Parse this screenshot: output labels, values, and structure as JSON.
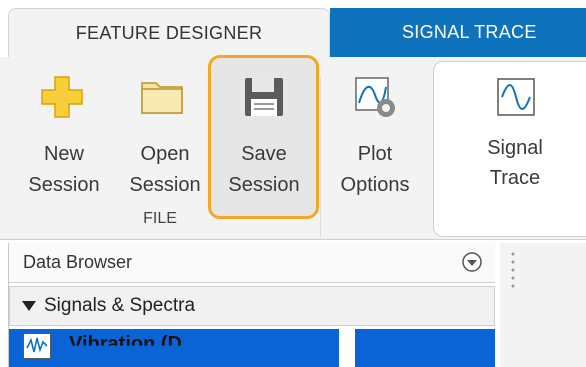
{
  "tabs": {
    "active": "FEATURE DESIGNER",
    "inactive": "SIGNAL TRACE"
  },
  "ribbon": {
    "buttons": [
      {
        "label": "New\nSession",
        "icon": "new-session-icon"
      },
      {
        "label": "Open\nSession",
        "icon": "folder-icon"
      },
      {
        "label": "Save\nSession",
        "icon": "save-icon"
      },
      {
        "label": "Plot\nOptions",
        "icon": "plot-options-icon"
      },
      {
        "label": "Signal\nTrace",
        "icon": "signal-trace-icon"
      }
    ],
    "group_label": "FILE",
    "highlight_color": "#f5a623"
  },
  "browser": {
    "title": "Data Browser",
    "section": "Signals & Spectra",
    "selected_row": "Vibration (D"
  },
  "colors": {
    "tab_accent": "#0e72bd",
    "selection": "#0a64d6"
  }
}
